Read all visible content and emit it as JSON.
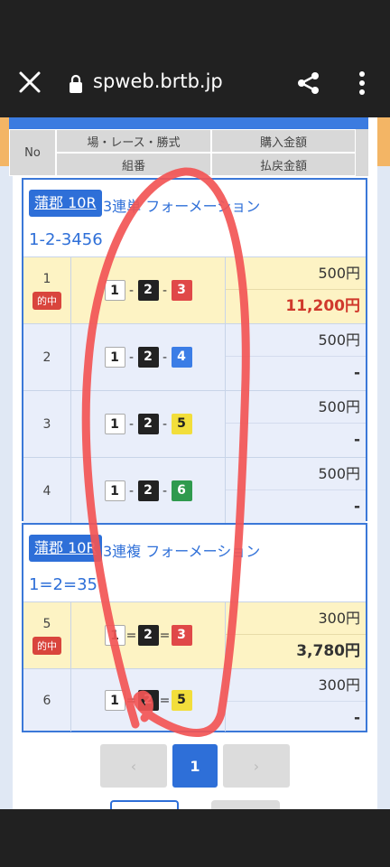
{
  "browser": {
    "url": "spweb.brtb.jp",
    "close_icon": "close-icon",
    "lock_icon": "lock-icon",
    "share_icon": "share-icon",
    "menu_icon": "more-vert-icon"
  },
  "table_header": {
    "no": "No",
    "venue_race": "場・レース・勝式",
    "combination": "組番",
    "purchase": "購入金額",
    "payout": "払戻金額"
  },
  "bets": [
    {
      "race": "蒲郡 10R",
      "type": "3連単 フォーメーション",
      "combo": "1-2-3456",
      "rows": [
        {
          "no": "1",
          "badge": "的中",
          "n1": "1",
          "n2": "2",
          "n3": "3",
          "sep": "-",
          "purchase": "500円",
          "payout": "11,200円"
        },
        {
          "no": "2",
          "badge": "",
          "n1": "1",
          "n2": "2",
          "n3": "4",
          "sep": "-",
          "purchase": "500円",
          "payout": "-"
        },
        {
          "no": "3",
          "badge": "",
          "n1": "1",
          "n2": "2",
          "n3": "5",
          "sep": "-",
          "purchase": "500円",
          "payout": "-"
        },
        {
          "no": "4",
          "badge": "",
          "n1": "1",
          "n2": "2",
          "n3": "6",
          "sep": "-",
          "purchase": "500円",
          "payout": "-"
        }
      ]
    },
    {
      "race": "蒲郡 10R",
      "type": "3連複 フォーメーション",
      "combo": "1=2=35",
      "rows": [
        {
          "no": "5",
          "badge": "的中",
          "n1": "1",
          "n2": "2",
          "n3": "3",
          "sep": "=",
          "purchase": "300円",
          "payout": "3,780円"
        },
        {
          "no": "6",
          "badge": "",
          "n1": "1",
          "n2": "2",
          "n3": "5",
          "sep": "=",
          "purchase": "300円",
          "payout": "-"
        }
      ]
    }
  ],
  "pagination": {
    "prev": "‹",
    "current": "1",
    "next": "›"
  },
  "colors": {
    "accent": "#2e6fd8",
    "hit_bg": "#fdf3c4",
    "payout_red": "#d0392c",
    "scribble": "#f25555"
  }
}
